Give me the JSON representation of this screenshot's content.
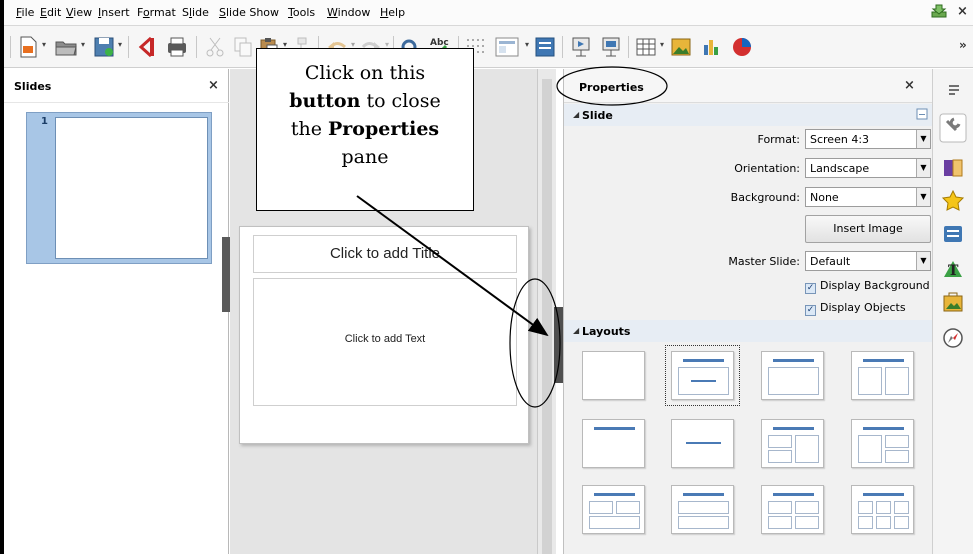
{
  "menu": {
    "items": [
      "File",
      "Edit",
      "View",
      "Insert",
      "Format",
      "Slide",
      "Slide Show",
      "Tools",
      "Window",
      "Help"
    ],
    "mnemonics": [
      "F",
      "E",
      "V",
      "I",
      "o",
      "l",
      "S",
      "T",
      "W",
      "H"
    ]
  },
  "slides_pane": {
    "title": "Slides",
    "slide_number": "1"
  },
  "slide": {
    "title_placeholder": "Click to add Title",
    "content_placeholder": "Click to add Text"
  },
  "callout": {
    "line1": "Click on this",
    "line2_bold": "button",
    "line2_rest": " to close",
    "line3_pre": "the ",
    "line3_bold": "Properties",
    "line4": "pane"
  },
  "properties": {
    "title": "Properties",
    "slide_section": "Slide",
    "format_label": "Format:",
    "format_value": "Screen 4:3",
    "orientation_label": "Orientation:",
    "orientation_value": "Landscape",
    "background_label": "Background:",
    "background_value": "None",
    "insert_image": "Insert Image",
    "master_label": "Master Slide:",
    "master_value": "Default",
    "display_background": "Display Background",
    "display_objects": "Display Objects",
    "layouts_section": "Layouts"
  },
  "colors": {
    "accent": "#4a7ab5",
    "selection": "#a8c6e6"
  }
}
